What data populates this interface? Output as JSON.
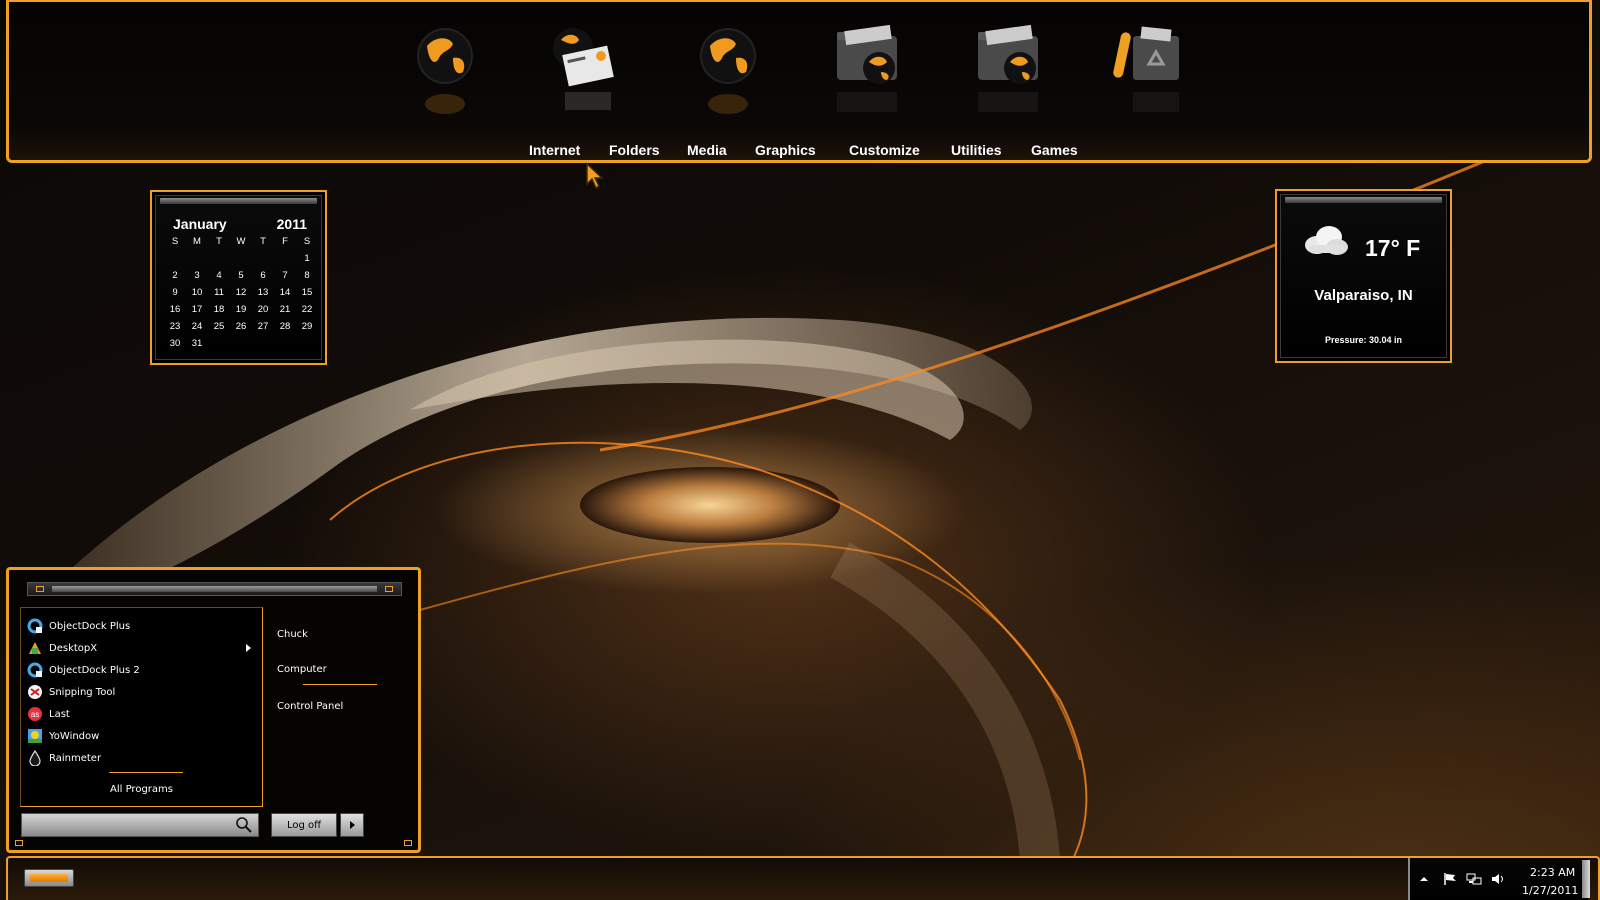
{
  "dock": {
    "icons": [
      {
        "name": "globe-icon"
      },
      {
        "name": "mail-globe-icon"
      },
      {
        "name": "globe-icon"
      },
      {
        "name": "folder-globe-icon"
      },
      {
        "name": "folder-globe-icon"
      },
      {
        "name": "recycle-bin-icon"
      }
    ],
    "menu": [
      "Internet",
      "Folders",
      "Media",
      "Graphics",
      "Customize",
      "Utilities",
      "Games"
    ]
  },
  "calendar": {
    "month": "January",
    "year": "2011",
    "weekdays": [
      "S",
      "M",
      "T",
      "W",
      "T",
      "F",
      "S"
    ],
    "weeks": [
      [
        "",
        "",
        "",
        "",
        "",
        "",
        "1"
      ],
      [
        "2",
        "3",
        "4",
        "5",
        "6",
        "7",
        "8"
      ],
      [
        "9",
        "10",
        "11",
        "12",
        "13",
        "14",
        "15"
      ],
      [
        "16",
        "17",
        "18",
        "19",
        "20",
        "21",
        "22"
      ],
      [
        "23",
        "24",
        "25",
        "26",
        "27",
        "28",
        "29"
      ],
      [
        "30",
        "31",
        "",
        "",
        "",
        "",
        ""
      ]
    ]
  },
  "weather": {
    "icon": "cloud-icon",
    "temperature": "17° F",
    "location": "Valparaiso, IN",
    "pressure": "Pressure: 30.04 in"
  },
  "start_menu": {
    "programs": [
      {
        "label": "ObjectDock Plus",
        "icon": "objectdock-icon",
        "submenu": false
      },
      {
        "label": "DesktopX",
        "icon": "desktopx-icon",
        "submenu": true
      },
      {
        "label": "ObjectDock Plus 2",
        "icon": "objectdock-icon",
        "submenu": false
      },
      {
        "label": "Snipping Tool",
        "icon": "snipping-tool-icon",
        "submenu": false
      },
      {
        "label": "Last",
        "icon": "lastfm-icon",
        "submenu": false
      },
      {
        "label": "YoWindow",
        "icon": "yowindow-icon",
        "submenu": false
      },
      {
        "label": "Rainmeter",
        "icon": "rainmeter-icon",
        "submenu": false
      }
    ],
    "all_programs": "All Programs",
    "right_items": [
      "Chuck",
      "Computer",
      "Control Panel"
    ],
    "search_placeholder": "",
    "logoff_label": "Log off"
  },
  "taskbar": {
    "time": "2:23 AM",
    "date": "1/27/2011",
    "tray_icons": [
      "show-hidden-icons-arrow",
      "action-center-flag-icon",
      "network-icon",
      "volume-icon"
    ]
  },
  "colors": {
    "accent": "#f0a020",
    "background": "#0a0807"
  }
}
